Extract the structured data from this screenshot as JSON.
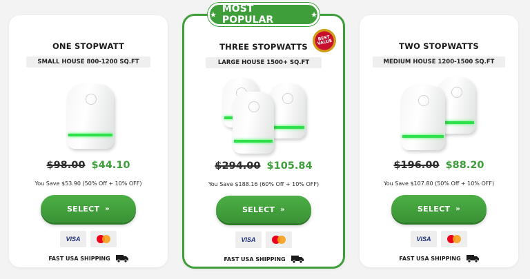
{
  "featured_badge": {
    "label": "MOST POPULAR",
    "star_left": "★",
    "star_right": "★"
  },
  "best_value_seal": {
    "text": "BEST VALUE"
  },
  "cards": [
    {
      "title": "ONE STOPWATT",
      "subtitle": "SMALL HOUSE 800-1200 SQ.FT",
      "price_old": "$98.00",
      "price_new": "$44.10",
      "savings": "You Save $53.90 (50% Off + 10% OFF)",
      "select_label": "SELECT",
      "visa": "VISA",
      "shipping": "FAST USA SHIPPING"
    },
    {
      "title": "THREE STOPWATTS",
      "subtitle": "LARGE HOUSE 1500+ SQ.FT",
      "price_old": "$294.00",
      "price_new": "$105.84",
      "savings": "You Save $188.16 (60% Off + 10% OFF)",
      "select_label": "SELECT",
      "visa": "VISA",
      "shipping": "FAST USA SHIPPING"
    },
    {
      "title": "TWO STOPWATTS",
      "subtitle": "MEDIUM HOUSE 1200-1500 SQ.FT",
      "price_old": "$196.00",
      "price_new": "$88.20",
      "savings": "You Save $107.80 (50% Off + 10% OFF)",
      "select_label": "SELECT",
      "visa": "VISA",
      "shipping": "FAST USA SHIPPING"
    }
  ],
  "colors": {
    "accent_green": "#3d9e3a",
    "led_green": "#2fe04a",
    "background": "#f2f3f2"
  },
  "icons": [
    "star-icon",
    "double-chevron-right-icon",
    "visa-icon",
    "mastercard-icon",
    "truck-icon",
    "device-icon"
  ]
}
